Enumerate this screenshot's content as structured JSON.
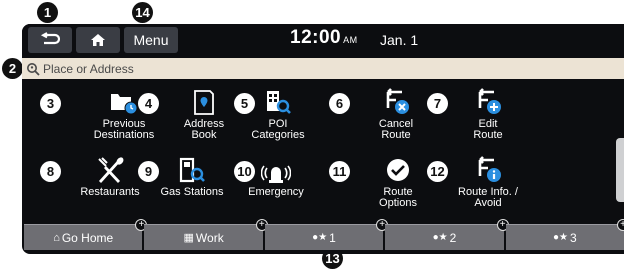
{
  "topbar": {
    "menu_label": "Menu",
    "time": "12:00",
    "ampm": "AM",
    "date": "Jan. 1"
  },
  "search": {
    "placeholder": "Place or Address"
  },
  "grid": [
    {
      "label": "Previous\nDestinations",
      "icon": "previous-destinations-icon"
    },
    {
      "label": "Address\nBook",
      "icon": "address-book-icon"
    },
    {
      "label": "POI\nCategories",
      "icon": "poi-categories-icon"
    },
    {
      "label": "Cancel\nRoute",
      "icon": "cancel-route-icon"
    },
    {
      "label": "Edit\nRoute",
      "icon": "edit-route-icon"
    },
    {
      "label": "Restaurants",
      "icon": "restaurants-icon"
    },
    {
      "label": "Gas Stations",
      "icon": "gas-stations-icon"
    },
    {
      "label": "Emergency",
      "icon": "emergency-icon"
    },
    {
      "label": "Route\nOptions",
      "icon": "route-options-icon"
    },
    {
      "label": "Route Info. /\nAvoid",
      "icon": "route-info-icon"
    }
  ],
  "bottom": [
    {
      "label": "Go Home",
      "icon": "home-icon"
    },
    {
      "label": "Work",
      "icon": "building-icon"
    },
    {
      "label": "1",
      "icon": "star-pin-icon"
    },
    {
      "label": "2",
      "icon": "star-pin-icon"
    },
    {
      "label": "3",
      "icon": "star-pin-icon"
    }
  ],
  "callouts": [
    "1",
    "2",
    "3",
    "4",
    "5",
    "6",
    "7",
    "8",
    "9",
    "10",
    "11",
    "12",
    "13",
    "14"
  ],
  "colors": {
    "screen": "#0c0d10",
    "search_bg": "#ece3d4",
    "accent_blue": "#2b8fe0",
    "button": "#3a3d44",
    "bottom_button": "#6e6e73"
  }
}
